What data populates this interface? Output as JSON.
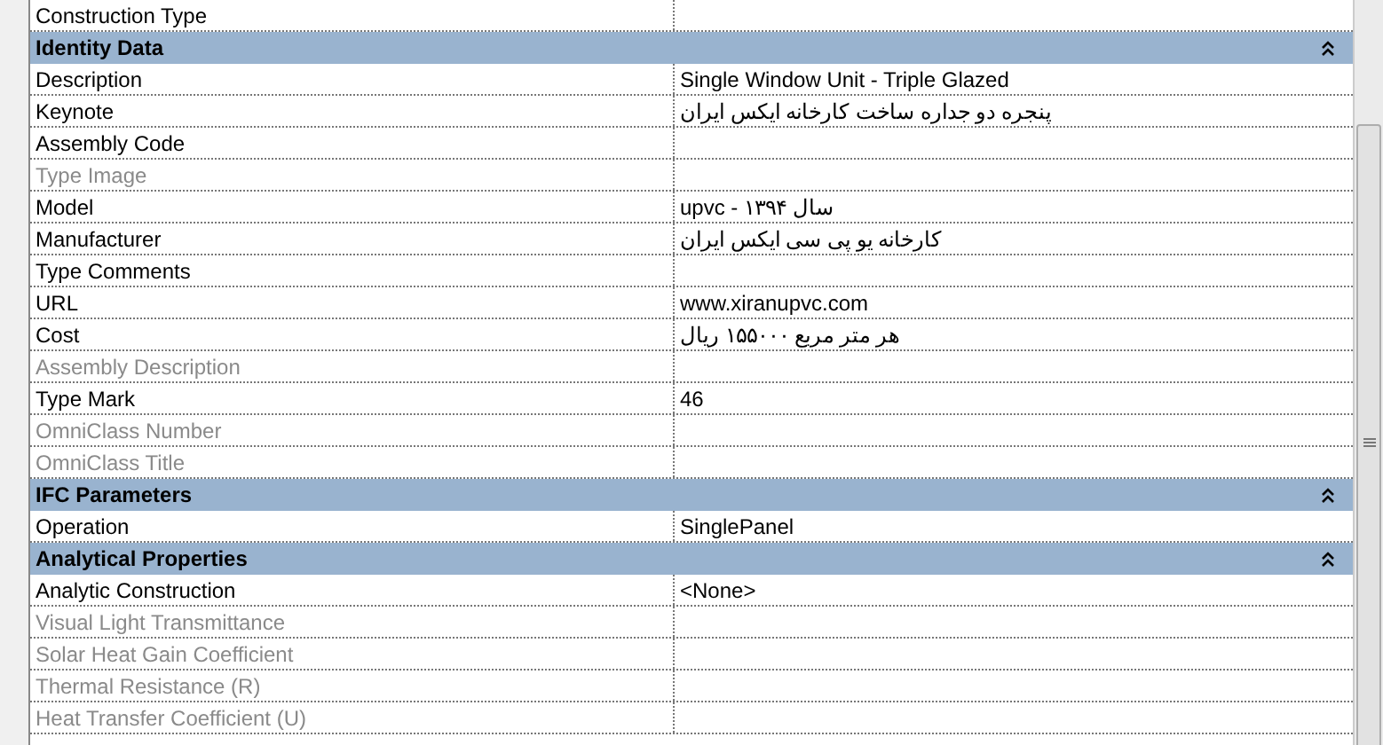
{
  "leading_rows": [
    {
      "name": "Construction Type",
      "value": "",
      "disabled": false
    }
  ],
  "sections": [
    {
      "title": "Identity Data",
      "expanded": true,
      "rows": [
        {
          "name": "Description",
          "value": "Single Window Unit - Triple Glazed",
          "disabled": false
        },
        {
          "name": "Keynote",
          "value": "پنجره دو جداره ساخت کارخانه ایکس ایران",
          "disabled": false
        },
        {
          "name": "Assembly Code",
          "value": "",
          "disabled": false
        },
        {
          "name": "Type Image",
          "value": "",
          "disabled": true
        },
        {
          "name": "Model",
          "value": "upvc - سال ۱۳۹۴",
          "disabled": false
        },
        {
          "name": "Manufacturer",
          "value": "کارخانه یو پی سی ایکس ایران",
          "disabled": false
        },
        {
          "name": "Type Comments",
          "value": "",
          "disabled": false
        },
        {
          "name": "URL",
          "value": "www.xiranupvc.com",
          "disabled": false
        },
        {
          "name": "Cost",
          "value": "هر متر مربع ۱۵۵۰۰۰ ریال",
          "disabled": false
        },
        {
          "name": "Assembly Description",
          "value": "",
          "disabled": true
        },
        {
          "name": "Type Mark",
          "value": "46",
          "disabled": false
        },
        {
          "name": "OmniClass Number",
          "value": "",
          "disabled": true
        },
        {
          "name": "OmniClass Title",
          "value": "",
          "disabled": true
        }
      ]
    },
    {
      "title": "IFC Parameters",
      "expanded": true,
      "rows": [
        {
          "name": "Operation",
          "value": "SinglePanel",
          "disabled": false
        }
      ]
    },
    {
      "title": "Analytical Properties",
      "expanded": true,
      "rows": [
        {
          "name": "Analytic Construction",
          "value": "<None>",
          "disabled": false
        },
        {
          "name": "Visual Light Transmittance",
          "value": "",
          "disabled": true
        },
        {
          "name": "Solar Heat Gain Coefficient",
          "value": "",
          "disabled": true
        },
        {
          "name": "Thermal Resistance (R)",
          "value": "",
          "disabled": true
        },
        {
          "name": "Heat Transfer Coefficient (U)",
          "value": "",
          "disabled": true
        }
      ]
    }
  ]
}
